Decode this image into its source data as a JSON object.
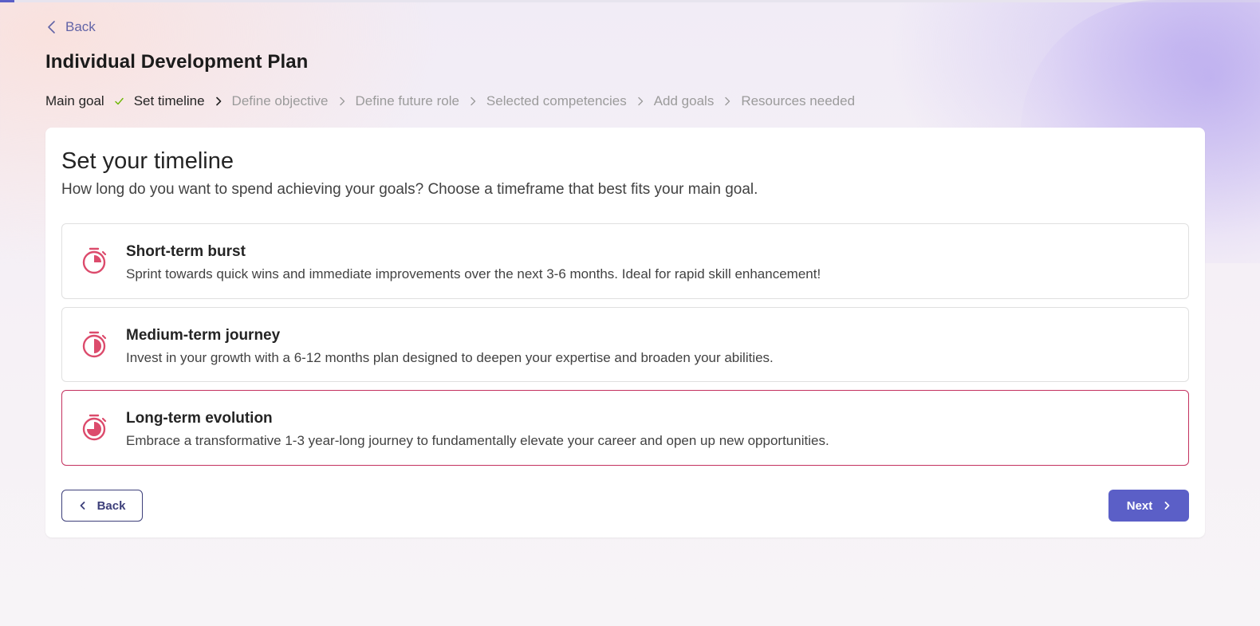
{
  "header": {
    "back_label": "Back",
    "title": "Individual Development Plan"
  },
  "stepper": {
    "steps": [
      {
        "label": "Main goal",
        "state": "done"
      },
      {
        "label": "Set timeline",
        "state": "current"
      },
      {
        "label": "Define objective",
        "state": "future"
      },
      {
        "label": "Define future role",
        "state": "future"
      },
      {
        "label": "Selected competencies",
        "state": "future"
      },
      {
        "label": "Add goals",
        "state": "future"
      },
      {
        "label": "Resources needed",
        "state": "future"
      }
    ]
  },
  "main": {
    "title": "Set your timeline",
    "subtitle": "How long do you want to spend achieving your goals? Choose a timeframe that best fits your main goal.",
    "options": [
      {
        "title": "Short-term burst",
        "description": "Sprint towards quick wins and immediate improvements over the next 3-6 months. Ideal for rapid skill enhancement!",
        "icon": "timer-quarter-icon",
        "selected": false
      },
      {
        "title": "Medium-term journey",
        "description": "Invest in your growth with a 6-12 months plan designed to deepen your expertise and broaden your abilities.",
        "icon": "timer-half-icon",
        "selected": false
      },
      {
        "title": "Long-term evolution",
        "description": "Embrace a transformative 1-3 year-long journey to fundamentally elevate your career and open up new opportunities.",
        "icon": "timer-three-quarter-icon",
        "selected": true
      }
    ]
  },
  "footer": {
    "back_label": "Back",
    "next_label": "Next"
  },
  "colors": {
    "accent": "#5b5fc7",
    "link": "#6264a7",
    "icon": "#dc4b6c",
    "selected_border": "#c4315f",
    "check": "#6bb700"
  }
}
